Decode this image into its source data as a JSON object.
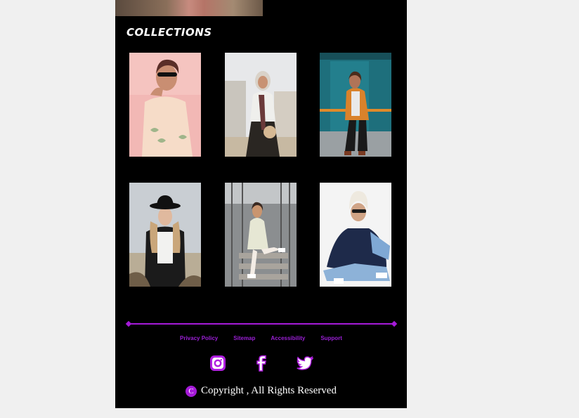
{
  "collections": {
    "title": "COLLECTIONS",
    "items": [
      {
        "name": "collection-photo-1"
      },
      {
        "name": "collection-photo-2"
      },
      {
        "name": "collection-photo-3"
      },
      {
        "name": "collection-photo-4"
      },
      {
        "name": "collection-photo-5"
      },
      {
        "name": "collection-photo-6"
      }
    ]
  },
  "footer": {
    "links": [
      "Privacy Policy",
      "Sitemap",
      "Accessibility",
      "Support"
    ],
    "socials": [
      "instagram-icon",
      "facebook-icon",
      "twitter-icon"
    ],
    "copyright_symbol": "C",
    "copyright_text": "Copyright , All Rights Reserved"
  },
  "colors": {
    "background": "#000000",
    "accent": "#a51ad8",
    "page_bg": "#f0f0f0"
  }
}
